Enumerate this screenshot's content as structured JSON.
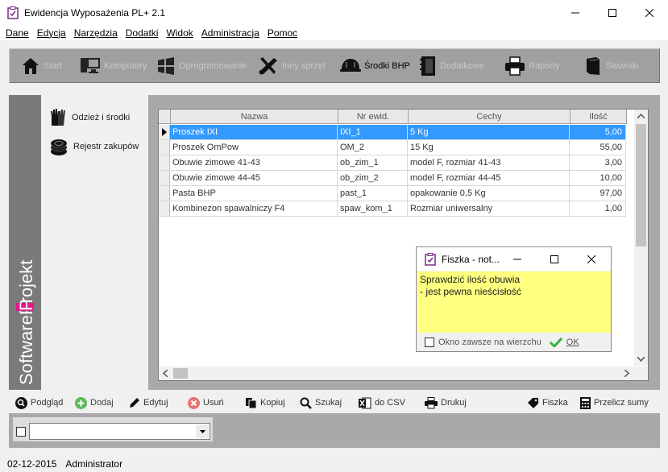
{
  "window": {
    "title": "Ewidencja Wyposażenia PL+ 2.1"
  },
  "menu": [
    "Dane",
    "Edycja",
    "Narzędzia",
    "Dodatki",
    "Widok",
    "Administracja",
    "Pomoc"
  ],
  "toolbar": {
    "buttons": [
      {
        "label": "Start",
        "icon": "home-icon",
        "active": false
      },
      {
        "label": "Komputery",
        "icon": "computer-icon",
        "active": false
      },
      {
        "label": "Oprogramowanie",
        "icon": "windows-icon",
        "active": false
      },
      {
        "label": "Inny sprzęt",
        "icon": "tools-icon",
        "active": false
      },
      {
        "label": "Środki BHP",
        "icon": "helmet-icon",
        "active": true
      },
      {
        "label": "Dodatkowe",
        "icon": "notebook-icon",
        "active": false
      },
      {
        "label": "Raporty",
        "icon": "printer-icon",
        "active": false
      },
      {
        "label": "Słowniki",
        "icon": "book-icon",
        "active": false
      }
    ]
  },
  "brand": {
    "part1": "Software",
    "part2": "Projekt"
  },
  "left_nav": [
    {
      "label": "Odzież i środki",
      "icon": "gloves-icon",
      "active": true
    },
    {
      "label": "Rejestr zakupów",
      "icon": "coins-icon",
      "active": false
    }
  ],
  "grid": {
    "columns": [
      "Nazwa",
      "Nr ewid.",
      "Cechy",
      "Ilość"
    ],
    "rows": [
      [
        "Proszek IXI",
        "IXI_1",
        "5 Kg",
        "5,00"
      ],
      [
        "Proszek OmPow",
        "OM_2",
        "15 Kg",
        "55,00"
      ],
      [
        "Obuwie zimowe 41-43",
        "ob_zim_1",
        "model F, rozmiar 41-43",
        "3,00"
      ],
      [
        "Obuwie zimowe 44-45",
        "ob_zim_2",
        "model F, rozmiar 44-45",
        "10,00"
      ],
      [
        "Pasta BHP",
        "past_1",
        "opakowanie 0,5 Kg",
        "97,00"
      ],
      [
        "Kombinezon spawalniczy F4",
        "spaw_kom_1",
        "Rozmiar uniwersalny",
        "1,00"
      ]
    ],
    "selected_row": 0
  },
  "note": {
    "title": "Fiszka - not...",
    "body_line1": "Sprawdzić ilość obuwia",
    "body_line2": "- jest pewna nieścisłość",
    "checkbox_label": "Okno zawsze na wierzchu",
    "ok_label": "OK"
  },
  "bottom_toolbar": {
    "preview": "Podgląd",
    "add": "Dodaj",
    "edit": "Edytuj",
    "delete": "Usuń",
    "copy": "Kopiuj",
    "search": "Szukaj",
    "csv": "do CSV",
    "print": "Drukuj",
    "note": "Fiszka",
    "recalc": "Przelicz sumy"
  },
  "status": {
    "date": "02-12-2015",
    "user": "Administrator"
  },
  "colors": {
    "selection": "#3399ff",
    "note_bg": "#ffff80",
    "brand_accent": "#e0198c"
  }
}
